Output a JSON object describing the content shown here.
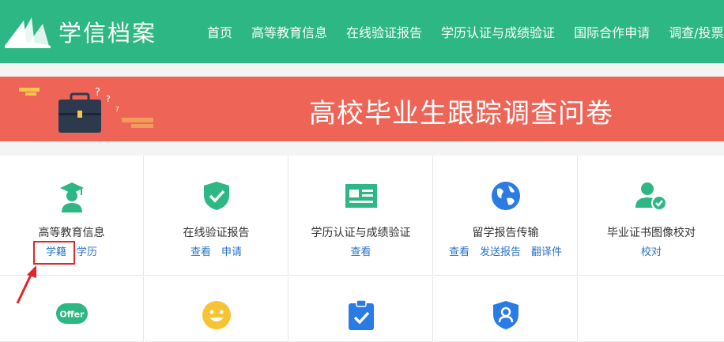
{
  "header": {
    "logo_text": "学信档案",
    "nav": [
      "首页",
      "高等教育信息",
      "在线验证报告",
      "学历认证与成绩验证",
      "国际合作申请",
      "调查/投票"
    ]
  },
  "banner": {
    "title": "高校毕业生跟踪调查问卷"
  },
  "services": [
    {
      "title": "高等教育信息",
      "links": [
        "学籍",
        "学历"
      ],
      "icon": "graduate-icon"
    },
    {
      "title": "在线验证报告",
      "links": [
        "查看",
        "申请"
      ],
      "icon": "shield-check-icon"
    },
    {
      "title": "学历认证与成绩验证",
      "links": [
        "查看"
      ],
      "icon": "id-card-icon"
    },
    {
      "title": "留学报告传输",
      "links": [
        "查看",
        "发送报告",
        "翻译件"
      ],
      "icon": "globe-icon"
    },
    {
      "title": "毕业证书图像校对",
      "links": [
        "校对"
      ],
      "icon": "user-check-icon"
    }
  ],
  "row2": {
    "offer_label": "Offer"
  },
  "colors": {
    "header_green": "#2db784",
    "banner_red": "#ee6457",
    "link_blue": "#2a72c5",
    "highlight_red": "#e0262a"
  }
}
